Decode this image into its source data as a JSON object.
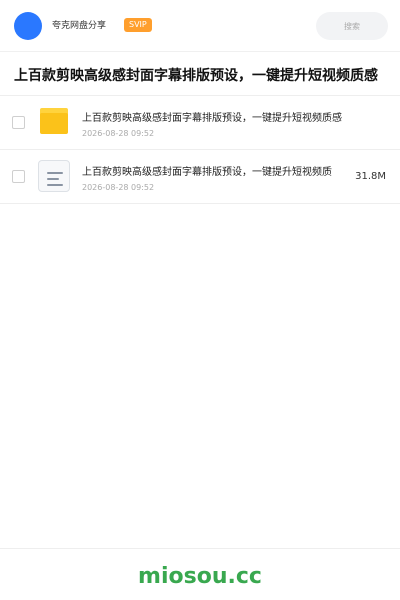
{
  "header": {
    "owner_name": "夸克网盘分享",
    "vip_label": "SVIP",
    "search_placeholder": "搜索"
  },
  "share_title": "上百款剪映高级感封面字幕排版预设，一键提升短视频质感",
  "files": [
    {
      "icon": "folder-icon",
      "name": "上百款剪映高级感封面字幕排版预设，一键提升短视频质感",
      "date": "2026-08-28 09:52",
      "size": ""
    },
    {
      "icon": "document-icon",
      "name": "上百款剪映高级感封面字幕排版预设，一键提升短视频质",
      "date": "2026-08-28 09:52",
      "size": "31.8M"
    }
  ],
  "footer": {
    "brand": "miosou.cc"
  },
  "colors": {
    "avatar": "#2a78ff",
    "vip_badge": "#ff9f2d",
    "folder": "#fbc21a",
    "brand": "#39a84f"
  }
}
